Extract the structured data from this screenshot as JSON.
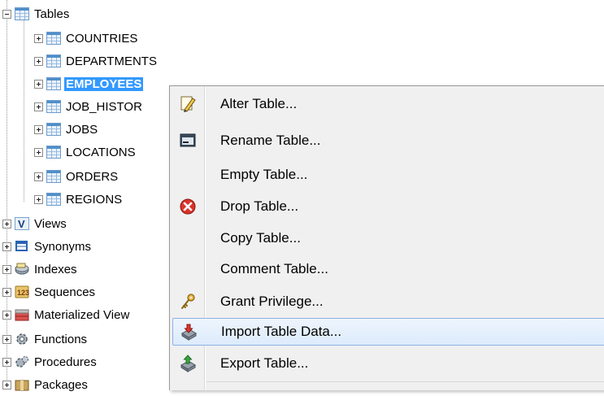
{
  "tree": {
    "tables_label": "Tables",
    "tables": [
      {
        "label": "COUNTRIES"
      },
      {
        "label": "DEPARTMENTS"
      },
      {
        "label": "EMPLOYEES",
        "selected": true
      },
      {
        "label": "JOB_HISTOR"
      },
      {
        "label": "JOBS"
      },
      {
        "label": "LOCATIONS"
      },
      {
        "label": "ORDERS"
      },
      {
        "label": "REGIONS"
      }
    ],
    "folders": [
      {
        "label": "Views",
        "icon": "view-icon"
      },
      {
        "label": "Synonyms",
        "icon": "synonym-icon"
      },
      {
        "label": "Indexes",
        "icon": "index-icon"
      },
      {
        "label": "Sequences",
        "icon": "sequence-icon"
      },
      {
        "label": "Materialized View",
        "icon": "materialized-view-icon"
      },
      {
        "label": "Functions",
        "icon": "function-icon"
      },
      {
        "label": "Procedures",
        "icon": "procedure-icon"
      },
      {
        "label": "Packages",
        "icon": "package-icon"
      }
    ]
  },
  "context_menu": {
    "items": [
      {
        "label": "Alter Table...",
        "icon": "pencil-icon"
      },
      {
        "label": "Rename Table...",
        "icon": "rename-icon"
      },
      {
        "label": "Empty Table...",
        "icon": ""
      },
      {
        "label": "Drop Table...",
        "icon": "delete-icon"
      },
      {
        "label": "Copy Table...",
        "icon": ""
      },
      {
        "label": "Comment Table...",
        "icon": ""
      },
      {
        "label": "Grant Privilege...",
        "icon": "key-icon"
      },
      {
        "label": "Import Table Data...",
        "icon": "import-icon",
        "highlighted": true
      },
      {
        "label": "Export Table...",
        "icon": "export-icon"
      }
    ]
  },
  "colors": {
    "selection": "#3399ff",
    "menu_background": "#f0f0f0",
    "highlight_border": "#8db2e3"
  }
}
